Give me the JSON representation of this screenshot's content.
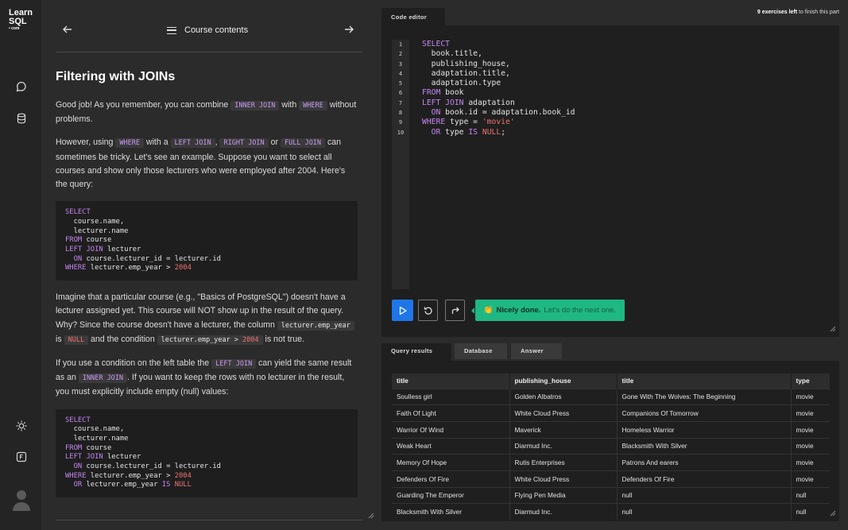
{
  "logo": {
    "line1": "Learn",
    "line2": "SQL",
    "line3": "• com"
  },
  "lesson": {
    "header_title": "Course contents",
    "title": "Filtering with JOINs",
    "p1": {
      "a": "Good job! As you remember, you can combine ",
      "code1": "INNER JOIN",
      "b": " with ",
      "code2": "WHERE",
      "c": " without problems."
    },
    "p2": {
      "a": "However, using ",
      "code1": "WHERE",
      "b": " with a ",
      "code2": "LEFT JOIN",
      "c": ", ",
      "code3": "RIGHT JOIN",
      "d": " or ",
      "code4": "FULL JOIN",
      "e": " can sometimes be tricky. Let's see an example. Suppose you want to select all courses and show only those lecturers who were employed after 2004. Here's the query:"
    },
    "p3": {
      "a": "Imagine that a particular course (e.g., \"Basics of PostgreSQL\") doesn't have a lecturer assigned yet. This course will NOT show up in the result of the query. Why? Since the course doesn't have a lecturer, the column ",
      "code1": "lecturer.emp_year",
      "b": " is ",
      "code2": "NULL",
      "c": " and the condition ",
      "code3a": "lecturer.emp_year > ",
      "code3b": "2004",
      "d": " is not true."
    },
    "p4": {
      "a": "If you use a condition on the left table the ",
      "code1": "LEFT JOIN",
      "b": " can yield the same result as an ",
      "code2": "INNER JOIN",
      "c": ". If you want to keep the rows with no lecturer in the result, you must explicitly include empty (null) values:"
    }
  },
  "editor": {
    "tab_label": "Code editor",
    "exercises_left_count": "9 exercises left",
    "exercises_left_rest": " to finish this part",
    "line_numbers": [
      "1",
      "2",
      "3",
      "4",
      "5",
      "6",
      "7",
      "8",
      "9",
      "10"
    ],
    "success_strong": "Nicely done.",
    "success_rest": " Let's do the next one."
  },
  "results": {
    "tabs": [
      "Query results",
      "Database",
      "Answer"
    ],
    "columns": [
      "title",
      "publishing_house",
      "title",
      "type"
    ],
    "rows": [
      [
        "Soulless girl",
        "Golden Albatros",
        "Gone With The Wolves: The Beginning",
        "movie"
      ],
      [
        "Faith Of Light",
        "White Cloud Press",
        "Companions Of Tomorrow",
        "movie"
      ],
      [
        "Warrior Of Wind",
        "Maverick",
        "Homeless Warrior",
        "movie"
      ],
      [
        "Weak Heart",
        "Diarmud Inc.",
        "Blacksmith With Silver",
        "movie"
      ],
      [
        "Memory Of Hope",
        "Rutis Enterprises",
        "Patrons And earers",
        "movie"
      ],
      [
        "Defenders Of Fire",
        "White Cloud Press",
        "Defenders Of Fire",
        "movie"
      ],
      [
        "Guarding The Emperor",
        "Flying Pen Media",
        "null",
        "null"
      ],
      [
        "Blacksmith With Silver",
        "Diarmud Inc.",
        "null",
        "null"
      ]
    ]
  },
  "colors": {
    "accent_blue": "#1f76e8",
    "success_green": "#1fb883",
    "keyword_purple": "#c485f0",
    "number_red": "#f07171"
  }
}
